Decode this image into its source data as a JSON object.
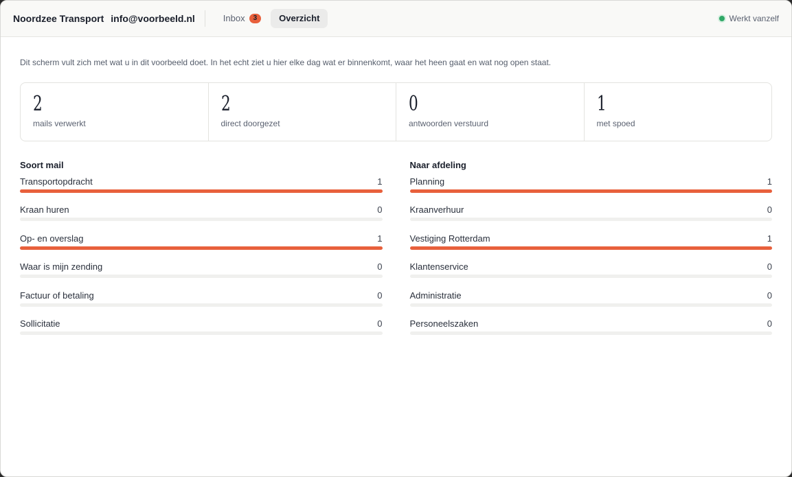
{
  "header": {
    "company": "Noordzee Transport",
    "email": "info@voorbeeld.nl",
    "tabs": [
      {
        "label": "Inbox",
        "badge": "3",
        "active": false
      },
      {
        "label": "Overzicht",
        "active": true
      }
    ],
    "status": "Werkt vanzelf"
  },
  "intro": "Dit scherm vult zich met wat u in dit voorbeeld doet. In het echt ziet u hier elke dag wat er binnenkomt, waar het heen gaat en wat nog open staat.",
  "stats": [
    {
      "value": "2",
      "label": "mails verwerkt"
    },
    {
      "value": "2",
      "label": "direct doorgezet"
    },
    {
      "value": "0",
      "label": "antwoorden verstuurd"
    },
    {
      "value": "1",
      "label": "met spoed"
    }
  ],
  "mail_types": {
    "title": "Soort mail",
    "items": [
      {
        "label": "Transportopdracht",
        "count": "1",
        "fraction": 1.0
      },
      {
        "label": "Kraan huren",
        "count": "0",
        "fraction": 0.0
      },
      {
        "label": "Op- en overslag",
        "count": "1",
        "fraction": 1.0
      },
      {
        "label": "Waar is mijn zending",
        "count": "0",
        "fraction": 0.0
      },
      {
        "label": "Factuur of betaling",
        "count": "0",
        "fraction": 0.0
      },
      {
        "label": "Sollicitatie",
        "count": "0",
        "fraction": 0.0
      }
    ]
  },
  "departments": {
    "title": "Naar afdeling",
    "items": [
      {
        "label": "Planning",
        "count": "1",
        "fraction": 1.0
      },
      {
        "label": "Kraanverhuur",
        "count": "0",
        "fraction": 0.0
      },
      {
        "label": "Vestiging Rotterdam",
        "count": "1",
        "fraction": 1.0
      },
      {
        "label": "Klantenservice",
        "count": "0",
        "fraction": 0.0
      },
      {
        "label": "Administratie",
        "count": "0",
        "fraction": 0.0
      },
      {
        "label": "Personeelszaken",
        "count": "0",
        "fraction": 0.0
      }
    ]
  },
  "colors": {
    "accent": "#e8603c",
    "status_ok": "#2fa866",
    "track": "#f0f0ee"
  }
}
